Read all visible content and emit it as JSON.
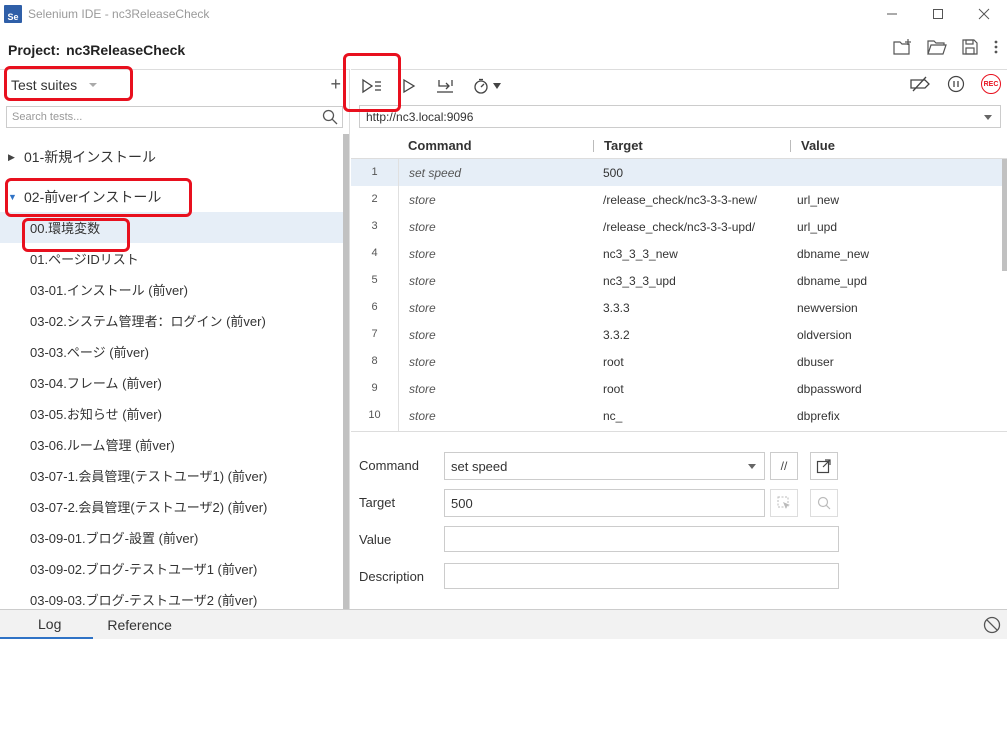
{
  "window": {
    "app_icon": "Se",
    "title": "Selenium IDE - nc3ReleaseCheck",
    "controls": [
      "minimize-icon",
      "maximize-icon",
      "close-icon"
    ]
  },
  "project": {
    "label": "Project:",
    "name": "nc3ReleaseCheck",
    "actions": [
      "new-project-icon",
      "open-folder-icon",
      "save-icon",
      "more-icon"
    ]
  },
  "left": {
    "suites_label": "Test suites",
    "add_label": "+",
    "search_placeholder": "Search tests...",
    "suites": [
      {
        "name": "01-新規インストール",
        "expanded": false
      },
      {
        "name": "02-前verインストール",
        "expanded": true
      }
    ],
    "tests": [
      "00.環境変数",
      "01.ページIDリスト",
      "03-01.インストール (前ver)",
      "03-02.システム管理者：ログイン (前ver)",
      "03-03.ページ (前ver)",
      "03-04.フレーム (前ver)",
      "03-05.お知らせ (前ver)",
      "03-06.ルーム管理 (前ver)",
      "03-07-1.会員管理(テストユーザ1) (前ver)",
      "03-07-2.会員管理(テストユーザ2) (前ver)",
      "03-09-01.ブログ-設置 (前ver)",
      "03-09-02.ブログ-テストユーザ1 (前ver)",
      "03-09-03.ブログ-テストユーザ2 (前ver)"
    ],
    "selected_test_index": 0
  },
  "toolbar": {
    "left_icons": [
      "run-all-tests-icon",
      "run-current-test-icon",
      "step-over-icon",
      "speed-icon"
    ],
    "right_icons": [
      "disable-breakpoints-icon",
      "pause-icon",
      "record-icon"
    ],
    "rec_label": "REC"
  },
  "url": {
    "value": "http://nc3.local:9096"
  },
  "table": {
    "headers": {
      "command": "Command",
      "target": "Target",
      "value": "Value"
    },
    "rows": [
      {
        "n": "1",
        "command": "set speed",
        "target": "500",
        "value": ""
      },
      {
        "n": "2",
        "command": "store",
        "target": "/release_check/nc3-3-3-new/",
        "value": "url_new"
      },
      {
        "n": "3",
        "command": "store",
        "target": "/release_check/nc3-3-3-upd/",
        "value": "url_upd"
      },
      {
        "n": "4",
        "command": "store",
        "target": "nc3_3_3_new",
        "value": "dbname_new"
      },
      {
        "n": "5",
        "command": "store",
        "target": "nc3_3_3_upd",
        "value": "dbname_upd"
      },
      {
        "n": "6",
        "command": "store",
        "target": "3.3.3",
        "value": "newversion"
      },
      {
        "n": "7",
        "command": "store",
        "target": "3.3.2",
        "value": "oldversion"
      },
      {
        "n": "8",
        "command": "store",
        "target": "root",
        "value": "dbuser"
      },
      {
        "n": "9",
        "command": "store",
        "target": "root",
        "value": "dbpassword"
      },
      {
        "n": "10",
        "command": "store",
        "target": "nc_",
        "value": "dbprefix"
      }
    ],
    "selected_row": 0
  },
  "editor": {
    "command_label": "Command",
    "command_value": "set speed",
    "comment_btn": "//",
    "target_label": "Target",
    "target_value": "500",
    "value_label": "Value",
    "value_value": "",
    "description_label": "Description",
    "description_value": ""
  },
  "bottom": {
    "tabs": [
      "Log",
      "Reference"
    ],
    "active_tab": "Log"
  },
  "colors": {
    "annotation_red": "#e8101e",
    "selection": "#e6eef7",
    "accent_blue": "#2f73c6"
  }
}
